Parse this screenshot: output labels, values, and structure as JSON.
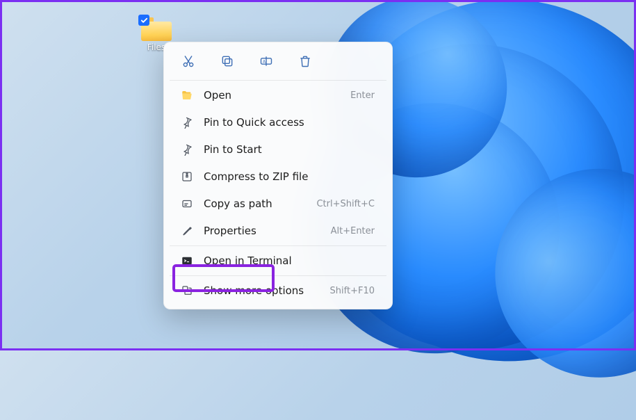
{
  "desktop": {
    "folder_label": "Files"
  },
  "toolbar": {
    "cut": "cut-icon",
    "copy": "copy-icon",
    "rename": "rename-icon",
    "delete": "delete-icon"
  },
  "menu": {
    "open": {
      "label": "Open",
      "shortcut": "Enter"
    },
    "pin_quick": {
      "label": "Pin to Quick access",
      "shortcut": ""
    },
    "pin_start": {
      "label": "Pin to Start",
      "shortcut": ""
    },
    "compress": {
      "label": "Compress to ZIP file",
      "shortcut": ""
    },
    "copy_path": {
      "label": "Copy as path",
      "shortcut": "Ctrl+Shift+C"
    },
    "properties": {
      "label": "Properties",
      "shortcut": "Alt+Enter"
    },
    "open_terminal": {
      "label": "Open in Terminal",
      "shortcut": ""
    },
    "more_options": {
      "label": "Show more options",
      "shortcut": "Shift+F10"
    }
  }
}
